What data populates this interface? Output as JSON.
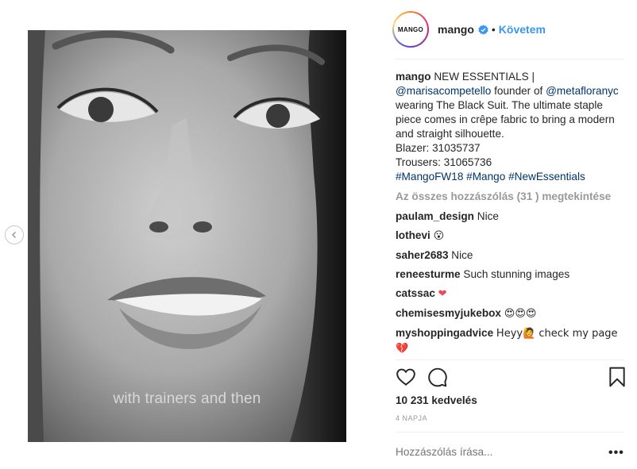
{
  "post": {
    "account": "mango",
    "avatar_text": "MANGO",
    "follow_label": "Követem",
    "separator": "•",
    "subtitle": "with trainers and then",
    "caption": {
      "username": "mango",
      "line1": "NEW ESSENTIALS |",
      "mention1": "@marisacompetello",
      "after_mention1": "founder of",
      "mention2": "@metafloranyc",
      "after_mention2": "wearing The Black Suit. The ultimate staple piece comes in crêpe fabric to bring a modern and straight silhouette.",
      "blazer": "Blazer: 31035737",
      "trousers": "Trousers: 31065736",
      "tag1": "#MangoFW18",
      "tag2": "#Mango",
      "tag3": "#NewEssentials"
    },
    "view_all_label": "Az összes hozzászólás (31 ) megtekintése",
    "comments": [
      {
        "user": "paulam_design",
        "text": "Nice"
      },
      {
        "user": "lothevi",
        "text": "😮"
      },
      {
        "user": "saher2683",
        "text": "Nice"
      },
      {
        "user": "reneesturme",
        "text": "Such stunning images"
      },
      {
        "user": "catssac",
        "text": "❤"
      },
      {
        "user": "chemisesmyjukebox",
        "text": "😍😍😍"
      },
      {
        "user": "myshoppingadvice",
        "text": "Heyy🙋 check my page 💔"
      }
    ],
    "likes": "10 231 kedvelés",
    "date": "4 NAPJA",
    "comment_placeholder": "Hozzászólás írása...",
    "more_label": "•••"
  },
  "icons": {
    "prev": "chevron-left-icon",
    "verified": "verified-badge-icon",
    "like": "heart-icon",
    "comment": "comment-bubble-icon",
    "save": "bookmark-icon"
  },
  "colors": {
    "link": "#003569",
    "follow": "#3897f0",
    "muted": "#999999",
    "heart": "#ed4956"
  }
}
